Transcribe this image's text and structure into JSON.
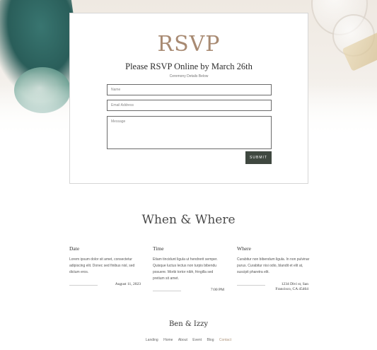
{
  "rsvp": {
    "title": "RSVP",
    "subtitle": "Please RSVP Online by March 26th",
    "note": "Ceremony Details Below",
    "name_placeholder": "Name",
    "email_placeholder": "Email Address",
    "message_placeholder": "Message",
    "submit_label": "SUBMIT"
  },
  "when_where": {
    "title": "When & Where",
    "columns": [
      {
        "heading": "Date",
        "body": "Lorem ipsum dolor sit amet, consectetur adipiscing elit. Donec sed finibus nisl, sed dictum eros.",
        "value_line1": "August 11, 2023",
        "value_line2": ""
      },
      {
        "heading": "Time",
        "body": "Etiam tincidunt ligula ut hendrerit semper. Quisque luctus lectus non turpis bibendu posuere. Morbi tortor nibh, fringilla sed pretium sit amet.",
        "value_line1": "7:00 PM",
        "value_line2": ""
      },
      {
        "heading": "Where",
        "body": "Curabitur non bibendum ligula. In non pulvinar purus. Curabitur nisi odio, blandit et elit at, suscipit pharetra elit.",
        "value_line1": "1234 Divi st, San",
        "value_line2": "Francisco, CA 45464"
      }
    ]
  },
  "footer": {
    "brand": "Ben & Izzy",
    "nav": [
      "Landing",
      "Home",
      "About",
      "Event",
      "Blog",
      "Contact"
    ],
    "active": "Contact"
  },
  "colors": {
    "accent_title": "#a88a72",
    "button_bg": "#3f4840",
    "nav_active": "#b0977d"
  }
}
